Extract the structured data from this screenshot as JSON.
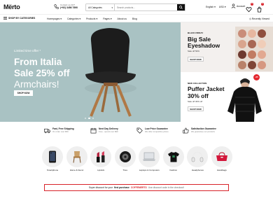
{
  "header": {
    "logo": "Mërto",
    "contact_label": "Contact us 24/7",
    "contact_phone": "(+92) 3456 7890",
    "search_category": "All Categories",
    "search_placeholder": "Search products...",
    "language": "English",
    "currency": "USD",
    "account_label": "Account",
    "wishlist_count": "0",
    "cart_count": "0"
  },
  "nav": {
    "shop_by_categories": "SHOP BY CATEGORIES",
    "links": [
      "Homepages",
      "Categories",
      "Products",
      "Pages",
      "About us",
      "Blog"
    ],
    "recently_viewed": "Recently Viewed"
  },
  "hero": {
    "subtitle": "Limited time offer *",
    "line1": "From Italia",
    "line2": "Sale 25% off",
    "line3": "Armchairs!",
    "button": "SHOP NOW",
    "bg_color": "#a9c2c3",
    "slides": 3,
    "active_slide": 2
  },
  "banner_top": {
    "tag": "BLACK FRIDAY",
    "title1": "Big Sale",
    "title2": "Eyeshadow",
    "desc": "Sale off 50%",
    "button": "SHOP NOW"
  },
  "banner_bottom": {
    "tag": "NEW COLLECTION",
    "title1": "Puffer Jacket",
    "title2": "30% off",
    "desc": "Sale off 30% off",
    "button": "SHOP NOW",
    "badge": "-25"
  },
  "features": [
    {
      "icon": "truck-icon",
      "title": "Fast, Free Shipping",
      "desc": "On order over $50"
    },
    {
      "icon": "calendar-icon",
      "title": "Next Day Delivery",
      "desc": "Free - spend over $99"
    },
    {
      "icon": "tag-icon",
      "title": "Low Price Guarantee",
      "desc": "We offer competitive prices"
    },
    {
      "icon": "thumbs-up-icon",
      "title": "Satisfaction Guarantee",
      "desc": "We guarantee our products"
    }
  ],
  "categories": [
    {
      "label": "Smartphone",
      "icon": "phone-icon"
    },
    {
      "label": "Home & Decor",
      "icon": "chair-icon"
    },
    {
      "label": "Lipstick",
      "icon": "lipstick-icon"
    },
    {
      "label": "Tires",
      "icon": "tire-icon"
    },
    {
      "label": "Laptops & Computers",
      "icon": "laptop-icon"
    },
    {
      "label": "Fashion",
      "icon": "tshirt-icon"
    },
    {
      "label": "Headphones",
      "icon": "headphones-icon"
    },
    {
      "label": "Handbags",
      "icon": "handbag-icon"
    }
  ],
  "promo": {
    "lead": "Super discount for your",
    "bold": "first purchase",
    "code": "COFFEMERTO",
    "rest": "Use discount code in the checkout!"
  },
  "colors": {
    "accent_red": "#d8232a",
    "dark": "#111111"
  }
}
